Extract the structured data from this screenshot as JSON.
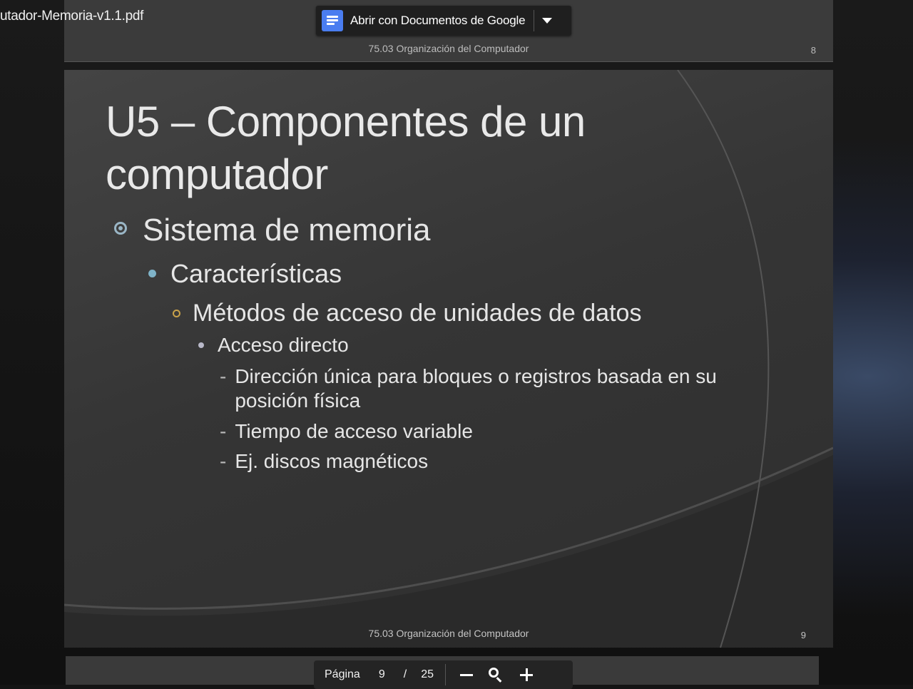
{
  "viewer": {
    "file_title": "utador-Memoria-v1.1.pdf",
    "open_button_label": "Abrir con Documentos de Google"
  },
  "previous_page": {
    "footer": "75.03 Organización del Computador",
    "page_number": "8"
  },
  "slide": {
    "title": "U5 – Componentes de un computador",
    "level1": "Sistema de memoria",
    "level2": "Características",
    "level3": "Métodos de acceso de unidades de datos",
    "level4": "Acceso directo",
    "level5": [
      "Dirección única para bloques o registros basada en su posición física",
      "Tiempo de acceso variable",
      "Ej. discos magnéticos"
    ],
    "dash": "-",
    "footer": "75.03 Organización del Computador",
    "page_number": "9"
  },
  "toolbar": {
    "page_label": "Página",
    "current_page": "9",
    "separator": "/",
    "total_pages": "25"
  },
  "icons": [
    "docs-icon",
    "dropdown-icon",
    "zoom-out-icon",
    "zoom-icon",
    "zoom-in-icon"
  ],
  "colors": {
    "docs_blue": "#4a7df0",
    "slide_bg": "#353535",
    "accent_teal": "#7fb3c8",
    "accent_gold": "#c9a24a"
  }
}
